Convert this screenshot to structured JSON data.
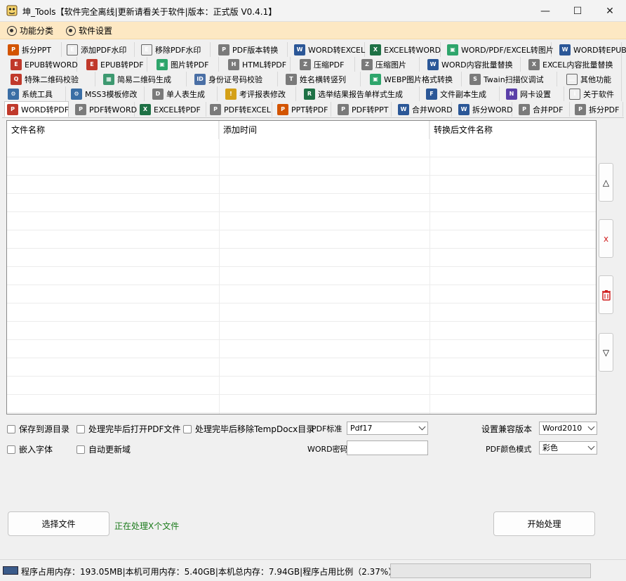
{
  "window": {
    "title": "坤_Tools【软件完全离线|更新请看关于软件|版本：正式版 V0.4.1】",
    "min_glyph": "—",
    "max_glyph": "☐",
    "close_glyph": "✕"
  },
  "menu": {
    "items": [
      {
        "label": "功能分类",
        "icon": "gear-icon"
      },
      {
        "label": "软件设置",
        "icon": "gear-icon"
      }
    ]
  },
  "tabs": {
    "row1": [
      "拆分PPT",
      "添加PDF水印",
      "移除PDF水印",
      "PDF版本转换",
      "WORD转EXCEL",
      "EXCEL转WORD",
      "WORD/PDF/EXCEL转图片",
      "WORD转EPUB"
    ],
    "row2": [
      "EPUB转WORD",
      "EPUB转PDF",
      "图片转PDF",
      "HTML转PDF",
      "压缩PDF",
      "压缩图片",
      "WORD内容批量替换",
      "EXCEL内容批量替换"
    ],
    "row3": [
      "特殊二维码校验",
      "简易二维码生成",
      "身份证号码校验",
      "姓名横转竖列",
      "WEBP图片格式转换",
      "Twain扫描仪调试",
      "其他功能"
    ],
    "row4": [
      "系统工具",
      "MSS3模板修改",
      "单人表生成",
      "考评报表修改",
      "选举结果报告单样式生成",
      "文件副本生成",
      "网卡设置",
      "关于软件"
    ],
    "row5": [
      "WORD转PDF",
      "PDF转WORD",
      "EXCEL转PDF",
      "PDF转EXCEL",
      "PPT转PDF",
      "PDF转PPT",
      "合并WORD",
      "拆分WORD",
      "合并PDF",
      "拆分PDF"
    ]
  },
  "table": {
    "headers": [
      "文件名称",
      "添加时间",
      "转换后文件名称"
    ]
  },
  "side_buttons": {
    "up": "△",
    "remove": "x",
    "clear": "🗑",
    "down": "▽"
  },
  "options": {
    "save_to_source": "保存到源目录",
    "open_after": "处理完毕后打开PDF文件",
    "remove_temp": "处理完毕后移除TempDocx目录",
    "embed_fonts": "嵌入字体",
    "auto_update": "自动更新域",
    "pdf_standard_label": "PDF标准",
    "pdf_standard_value": "Pdf17",
    "word_password_label": "WORD密码",
    "compat_label": "设置兼容版本",
    "compat_value": "Word2010",
    "color_mode_label": "PDF颜色模式",
    "color_mode_value": "彩色"
  },
  "actions": {
    "select_files": "选择文件",
    "processing": "正在处理X个文件",
    "start": "开始处理"
  },
  "status": {
    "text": "程序占用内存：193.05MB|本机可用内存：5.40GB|本机总内存：7.94GB|程序占用比例（2.37%）",
    "progress_percent": 0
  }
}
